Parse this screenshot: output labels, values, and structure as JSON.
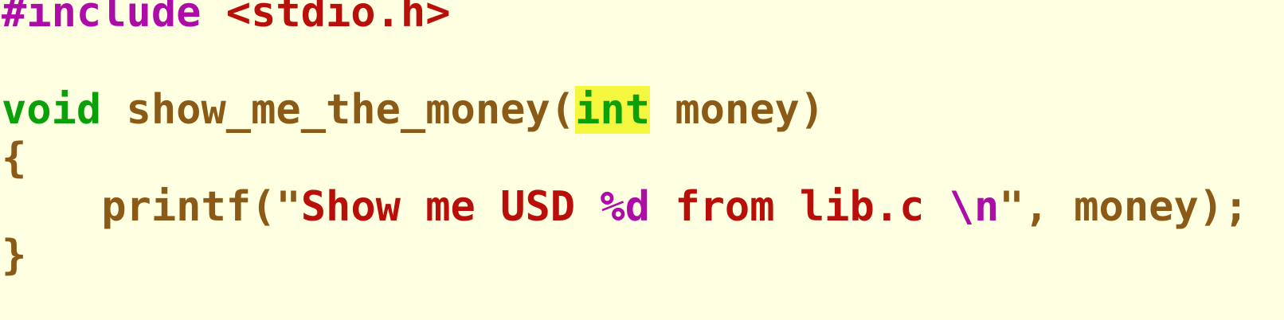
{
  "editor": {
    "lines": {
      "l0": {
        "directive": "#include",
        "sp": " ",
        "header": "<stdio.h>"
      },
      "l1": {},
      "l2": {
        "ret_type": "void",
        "sp1": " ",
        "func_name": "show_me_the_money",
        "open_paren": "(",
        "param_type": "int",
        "sp2": " ",
        "param_name": "money",
        "close_paren": ")"
      },
      "l3": {
        "brace": "{"
      },
      "l4": {
        "indent": "    ",
        "call": "printf",
        "open": "(\"",
        "str_a": "Show me USD ",
        "fmt": "%d",
        "str_b": " from lib.c ",
        "esc": "\\n",
        "close_q": "\"",
        "rest": ", money);"
      },
      "l5": {
        "brace": "}"
      }
    },
    "colors": {
      "background": "#ffffe1",
      "preprocessor": "#ad0ca8",
      "string": "#b80f0b",
      "type": "#0aa00a",
      "identifier": "#8b5a17",
      "highlight": "#f4f73e"
    }
  }
}
